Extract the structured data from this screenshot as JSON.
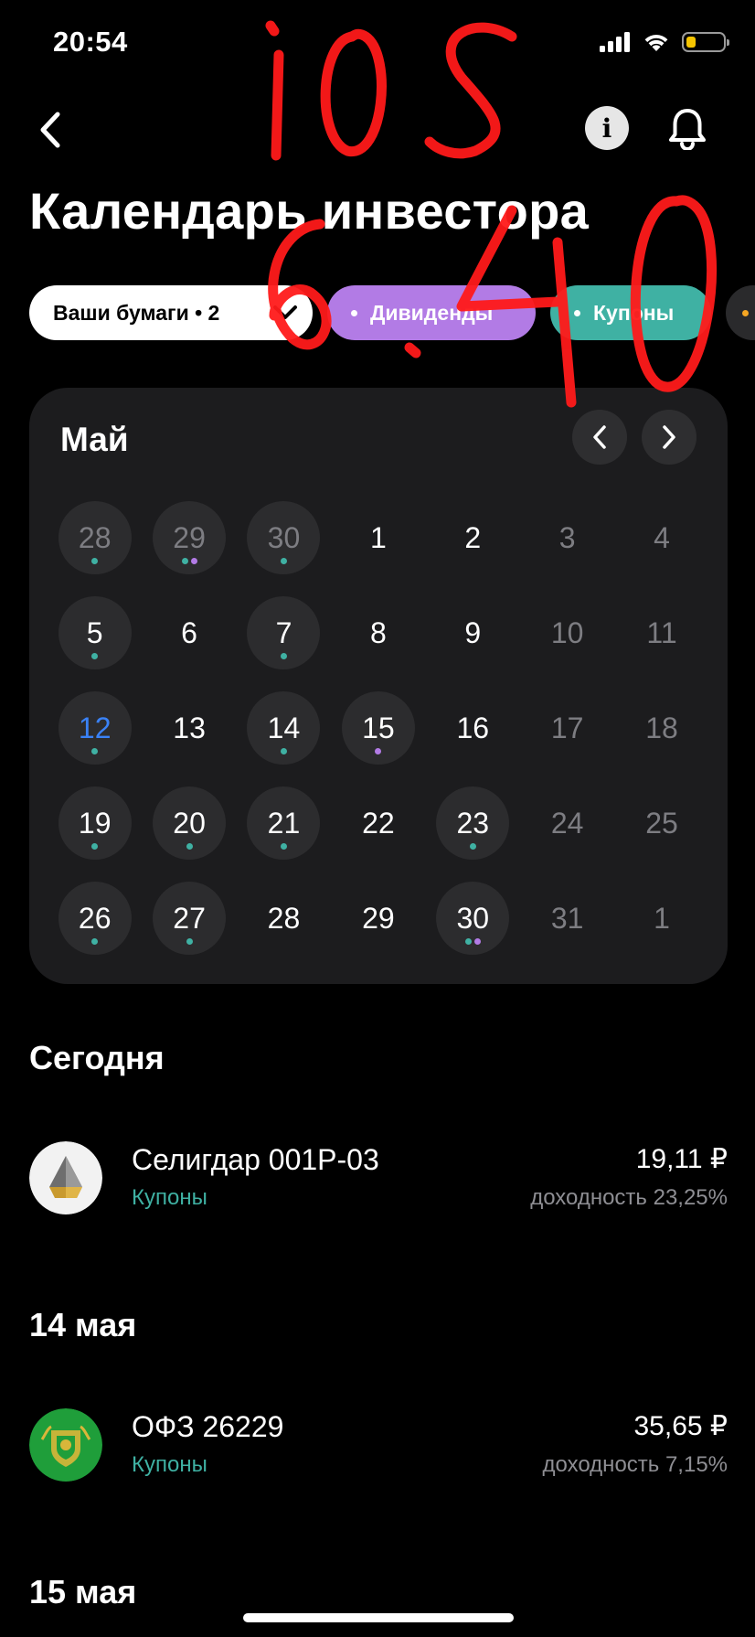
{
  "status_bar": {
    "time": "20:54",
    "battery_level": 0.25,
    "battery_color": "#f5c400"
  },
  "nav": {
    "back_icon": "chevron-left-icon",
    "info_icon": "info-icon",
    "bell_icon": "bell-icon"
  },
  "title": "Календарь инвестора",
  "chips": {
    "papers": "Ваши бумаги • 2",
    "dividends": "Дивиденды",
    "coupons": "Купоны"
  },
  "colors": {
    "dividend": "#b27be5",
    "coupon": "#3fb1a3",
    "today": "#3a82f7",
    "more": "#f5a623",
    "annotation": "#ff1a1a"
  },
  "calendar": {
    "month": "Май",
    "days": [
      {
        "d": "28",
        "muted": true,
        "filled": true,
        "dots": [
          "coupon"
        ]
      },
      {
        "d": "29",
        "muted": true,
        "filled": true,
        "dots": [
          "coupon",
          "dividend"
        ]
      },
      {
        "d": "30",
        "muted": true,
        "filled": true,
        "dots": [
          "coupon"
        ]
      },
      {
        "d": "1",
        "muted": false,
        "filled": false,
        "dots": []
      },
      {
        "d": "2",
        "muted": false,
        "filled": false,
        "dots": []
      },
      {
        "d": "3",
        "muted": true,
        "filled": false,
        "dots": []
      },
      {
        "d": "4",
        "muted": true,
        "filled": false,
        "dots": []
      },
      {
        "d": "5",
        "muted": false,
        "filled": true,
        "dots": [
          "coupon"
        ]
      },
      {
        "d": "6",
        "muted": false,
        "filled": false,
        "dots": []
      },
      {
        "d": "7",
        "muted": false,
        "filled": true,
        "dots": [
          "coupon"
        ]
      },
      {
        "d": "8",
        "muted": false,
        "filled": false,
        "dots": []
      },
      {
        "d": "9",
        "muted": false,
        "filled": false,
        "dots": []
      },
      {
        "d": "10",
        "muted": true,
        "filled": false,
        "dots": []
      },
      {
        "d": "11",
        "muted": true,
        "filled": false,
        "dots": []
      },
      {
        "d": "12",
        "muted": false,
        "filled": true,
        "today": true,
        "dots": [
          "coupon"
        ]
      },
      {
        "d": "13",
        "muted": false,
        "filled": false,
        "dots": []
      },
      {
        "d": "14",
        "muted": false,
        "filled": true,
        "dots": [
          "coupon"
        ]
      },
      {
        "d": "15",
        "muted": false,
        "filled": true,
        "dots": [
          "dividend"
        ]
      },
      {
        "d": "16",
        "muted": false,
        "filled": false,
        "dots": []
      },
      {
        "d": "17",
        "muted": true,
        "filled": false,
        "dots": []
      },
      {
        "d": "18",
        "muted": true,
        "filled": false,
        "dots": []
      },
      {
        "d": "19",
        "muted": false,
        "filled": true,
        "dots": [
          "coupon"
        ]
      },
      {
        "d": "20",
        "muted": false,
        "filled": true,
        "dots": [
          "coupon"
        ]
      },
      {
        "d": "21",
        "muted": false,
        "filled": true,
        "dots": [
          "coupon"
        ]
      },
      {
        "d": "22",
        "muted": false,
        "filled": false,
        "dots": []
      },
      {
        "d": "23",
        "muted": false,
        "filled": true,
        "dots": [
          "coupon"
        ]
      },
      {
        "d": "24",
        "muted": true,
        "filled": false,
        "dots": []
      },
      {
        "d": "25",
        "muted": true,
        "filled": false,
        "dots": []
      },
      {
        "d": "26",
        "muted": false,
        "filled": true,
        "dots": [
          "coupon"
        ]
      },
      {
        "d": "27",
        "muted": false,
        "filled": true,
        "dots": [
          "coupon"
        ]
      },
      {
        "d": "28",
        "muted": false,
        "filled": false,
        "dots": []
      },
      {
        "d": "29",
        "muted": false,
        "filled": false,
        "dots": []
      },
      {
        "d": "30",
        "muted": false,
        "filled": true,
        "dots": [
          "coupon",
          "dividend"
        ]
      },
      {
        "d": "31",
        "muted": true,
        "filled": false,
        "dots": []
      },
      {
        "d": "1",
        "muted": true,
        "filled": false,
        "dots": []
      }
    ]
  },
  "sections": [
    {
      "header": "Сегодня",
      "items": [
        {
          "name": "Селигдар 001Р-03",
          "type": "Купоны",
          "amount": "19,11 ₽",
          "yield": "доходность 23,25%",
          "logo": "seligdar-logo"
        }
      ]
    },
    {
      "header": "14 мая",
      "items": [
        {
          "name": "ОФЗ 26229",
          "type": "Купоны",
          "amount": "35,65 ₽",
          "yield": "доходность 7,15%",
          "logo": "minfin-emblem-logo"
        }
      ]
    },
    {
      "header": "15 мая",
      "items": []
    }
  ],
  "annotation": {
    "line1": "iOS",
    "line2": "6.40"
  }
}
